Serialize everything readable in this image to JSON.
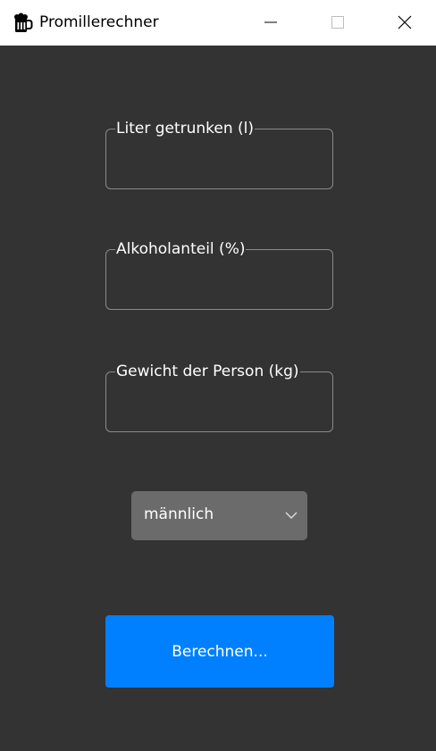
{
  "window": {
    "title": "Promillerechner",
    "app_icon": "beer-mug-icon",
    "controls": [
      "minimize-icon",
      "maximize-icon",
      "close-icon"
    ]
  },
  "form": {
    "liters": {
      "label": "Liter getrunken (l)",
      "value": ""
    },
    "alcohol": {
      "label": "Alkoholanteil (%)",
      "value": ""
    },
    "weight": {
      "label": "Gewicht der Person (kg)",
      "value": ""
    },
    "gender": {
      "selected": "männlich",
      "icon": "chevron-down-icon"
    },
    "calculate_label": "Berechnen..."
  },
  "colors": {
    "background": "#333333",
    "titlebar": "#ffffff",
    "field_border": "#8a8a8a",
    "select_bg": "#6b6b6b",
    "button": "#0080ff"
  }
}
